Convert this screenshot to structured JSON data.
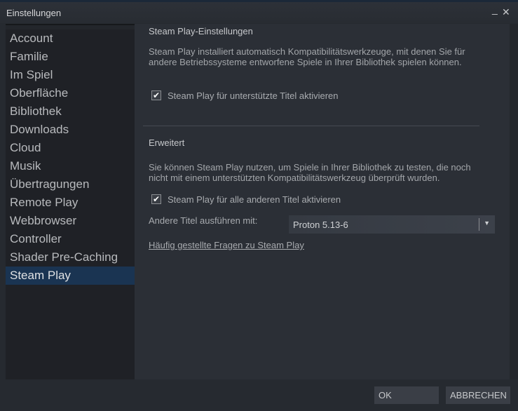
{
  "window": {
    "title": "Einstellungen",
    "minimize_label": "_",
    "close_label": "✕"
  },
  "sidebar": {
    "items": [
      {
        "label": "Account"
      },
      {
        "label": "Familie"
      },
      {
        "label": "Im Spiel"
      },
      {
        "label": "Oberfläche"
      },
      {
        "label": "Bibliothek"
      },
      {
        "label": "Downloads"
      },
      {
        "label": "Cloud"
      },
      {
        "label": "Musik"
      },
      {
        "label": "Übertragungen"
      },
      {
        "label": "Remote Play"
      },
      {
        "label": "Webbrowser"
      },
      {
        "label": "Controller"
      },
      {
        "label": "Shader Pre-Caching"
      },
      {
        "label": "Steam Play"
      }
    ],
    "selected": "Steam Play"
  },
  "main": {
    "section1_title": "Steam Play-Einstellungen",
    "section1_desc": "Steam Play installiert automatisch Kompatibilitätswerkzeuge, mit denen Sie für andere Betriebssysteme entworfene Spiele in Ihrer Bibliothek spielen können.",
    "checkbox1": {
      "label": "Steam Play für unterstützte Titel aktivieren",
      "checked": true,
      "mark": "✔"
    },
    "section2_title": "Erweitert",
    "section2_desc": "Sie können Steam Play nutzen, um Spiele in Ihrer Bibliothek zu testen, die noch nicht mit einem unterstützten Kompatibilitätswerkzeug überprüft wurden.",
    "checkbox2": {
      "label": "Steam Play für alle anderen Titel aktivieren",
      "checked": true,
      "mark": "✔"
    },
    "run_with_label": "Andere Titel ausführen mit:",
    "run_with_value": "Proton 5.13-6",
    "dropdown_arrow": "▼",
    "faq_link": "Häufig gestellte Fragen zu Steam Play"
  },
  "footer": {
    "ok": "OK",
    "cancel": "ABBRECHEN"
  }
}
